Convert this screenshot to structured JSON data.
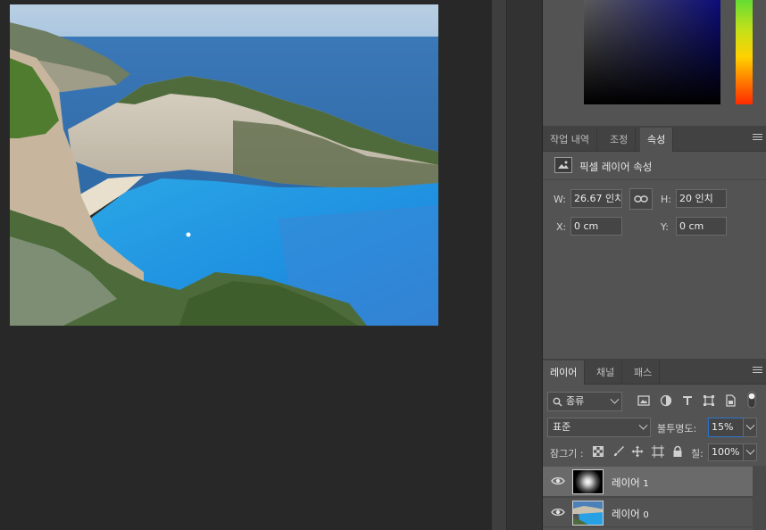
{
  "properties_tabs": {
    "history": "작업 내역",
    "adjustments": "조정",
    "properties": "속성"
  },
  "properties": {
    "title": "픽셀 레이어 속성",
    "width_label": "W:",
    "width_value": "26.67 인치",
    "height_label": "H:",
    "height_value": "20 인치",
    "x_label": "X:",
    "x_value": "0 cm",
    "y_label": "Y:",
    "y_value": "0 cm"
  },
  "layers_tabs": {
    "layers": "레이어",
    "channels": "채널",
    "paths": "패스"
  },
  "layers_panel": {
    "filter_kind": "종류",
    "blend_mode": "표준",
    "opacity_label": "불투명도:",
    "opacity_value": "15%",
    "lock_label": "잠그기 :",
    "fill_label": "칠:",
    "fill_value": "100%"
  },
  "layers": [
    {
      "name": "레이어",
      "num": "1",
      "selected": true
    },
    {
      "name": "레이어",
      "num": "0",
      "selected": false
    }
  ],
  "colors": {
    "panel_bg": "#535353",
    "canvas_bg": "#282828",
    "accent_focus": "#2d75c9"
  },
  "icons": [
    "menu-icon",
    "pixel-layer-icon",
    "link-icon",
    "search-icon",
    "filter-image-icon",
    "filter-adjustment-icon",
    "filter-type-icon",
    "filter-shape-icon",
    "filter-smart-object-icon",
    "filter-toggle-icon",
    "lock-transparent-icon",
    "lock-brush-icon",
    "lock-move-icon",
    "lock-artboard-icon",
    "lock-all-icon",
    "eye-icon"
  ]
}
